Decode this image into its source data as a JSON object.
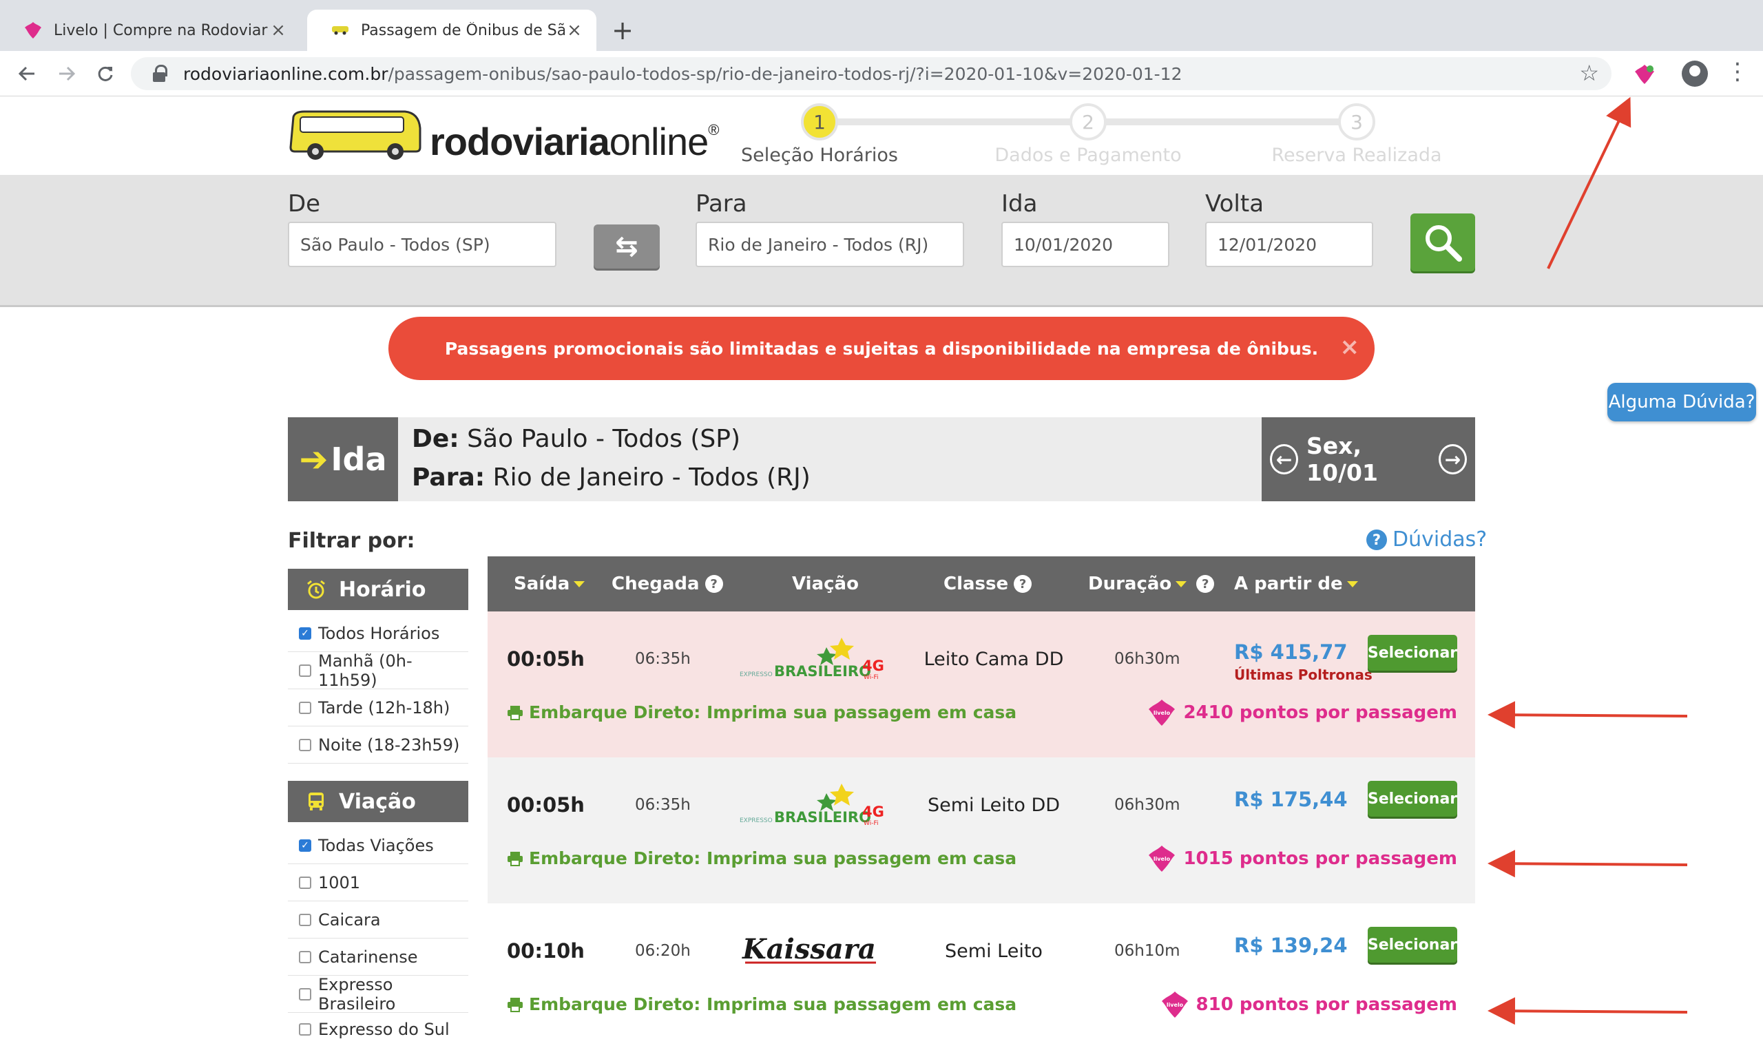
{
  "browser": {
    "tabs": [
      {
        "title": "Livelo | Compre na Rodoviaria Online",
        "active": false
      },
      {
        "title": "Passagem de Ônibus de São Paulo",
        "active": true
      }
    ],
    "url_host": "rodoviariaonline.com.br",
    "url_path": "/passagem-onibus/sao-paulo-todos-sp/rio-de-janeiro-todos-rj/?i=2020-01-10&v=2020-01-12"
  },
  "site": {
    "logo_bold": "rodoviaria",
    "logo_light": "online",
    "logo_mark": "®",
    "steps": [
      {
        "number": "1",
        "label": "Seleção Horários",
        "active": true
      },
      {
        "number": "2",
        "label": "Dados e Pagamento",
        "active": false
      },
      {
        "number": "3",
        "label": "Reserva Realizada",
        "active": false
      }
    ]
  },
  "search": {
    "from_label": "De",
    "from_value": "São Paulo - Todos (SP)",
    "to_label": "Para",
    "to_value": "Rio de Janeiro - Todos (RJ)",
    "depart_label": "Ida",
    "depart_value": "10/01/2020",
    "return_label": "Volta",
    "return_value": "12/01/2020"
  },
  "promo": {
    "text": "Passagens promocionais são limitadas e sujeitas a disponibilidade na empresa de ônibus.",
    "close": "×"
  },
  "help_bubble": "Alguma Dúvida?",
  "trip": {
    "direction": "Ida",
    "from_label": "De:",
    "from_value": "São Paulo - Todos (SP)",
    "to_label": "Para:",
    "to_value": "Rio de Janeiro - Todos (RJ)",
    "date": "Sex, 10/01"
  },
  "filters": {
    "title": "Filtrar por:",
    "help": "Dúvidas?",
    "time_group": {
      "heading": "Horário",
      "items": [
        {
          "label": "Todos Horários",
          "checked": true
        },
        {
          "label": "Manhã (0h-11h59)",
          "checked": false
        },
        {
          "label": "Tarde (12h-18h)",
          "checked": false
        },
        {
          "label": "Noite (18-23h59)",
          "checked": false
        }
      ]
    },
    "carrier_group": {
      "heading": "Viação",
      "items": [
        {
          "label": "Todas Viações",
          "checked": true
        },
        {
          "label": "1001",
          "checked": false
        },
        {
          "label": "Caicara",
          "checked": false
        },
        {
          "label": "Catarinense",
          "checked": false
        },
        {
          "label": "Expresso Brasileiro",
          "checked": false
        },
        {
          "label": "Expresso do Sul",
          "checked": false
        }
      ]
    }
  },
  "table": {
    "columns": [
      "Saída",
      "Chegada",
      "Viação",
      "Classe",
      "Duração",
      "A partir de"
    ],
    "select_label": "Selecionar",
    "embark_text": "Embarque Direto: Imprima sua passagem em casa",
    "rows": [
      {
        "departure": "00:05h",
        "arrival": "06:35h",
        "carrier": "Expresso Brasileiro",
        "carrier_logo_small": "EXPRESSO",
        "carrier_logo_main": "BRASILEIRO",
        "carrier_logo_badge": "4G",
        "carrier_logo_badge_sub": "Wi-Fi",
        "class": "Leito Cama DD",
        "duration": "06h30m",
        "price": "R$ 415,77",
        "note": "Últimas Poltronas",
        "points": "2410 pontos por passagem"
      },
      {
        "departure": "00:05h",
        "arrival": "06:35h",
        "carrier": "Expresso Brasileiro",
        "carrier_logo_small": "EXPRESSO",
        "carrier_logo_main": "BRASILEIRO",
        "carrier_logo_badge": "4G",
        "carrier_logo_badge_sub": "Wi-Fi",
        "class": "Semi Leito DD",
        "duration": "06h30m",
        "price": "R$ 175,44",
        "note": "",
        "points": "1015 pontos por passagem"
      },
      {
        "departure": "00:10h",
        "arrival": "06:20h",
        "carrier": "Kaissara",
        "carrier_logo_main": "Kaissara",
        "class": "Semi Leito",
        "duration": "06h10m",
        "price": "R$ 139,24",
        "note": "",
        "points": "810 pontos por passagem"
      }
    ]
  },
  "badges": {
    "livelo": "livelo"
  },
  "colors": {
    "brand_yellow": "#f2e234",
    "alert_red": "#ea4c3a",
    "action_green": "#4f9a30",
    "price_blue": "#3f8fd2",
    "points_pink": "#de2c8c",
    "annotation_arrow": "#e0402e"
  },
  "icons": [
    "back-arrow-icon",
    "forward-arrow-icon",
    "reload-icon",
    "lock-icon",
    "star-icon",
    "livelo-extension-icon",
    "profile-icon",
    "menu-icon",
    "swap-icon",
    "search-icon",
    "alarm-clock-icon",
    "bus-icon",
    "printer-icon",
    "livelo-badge-icon"
  ]
}
